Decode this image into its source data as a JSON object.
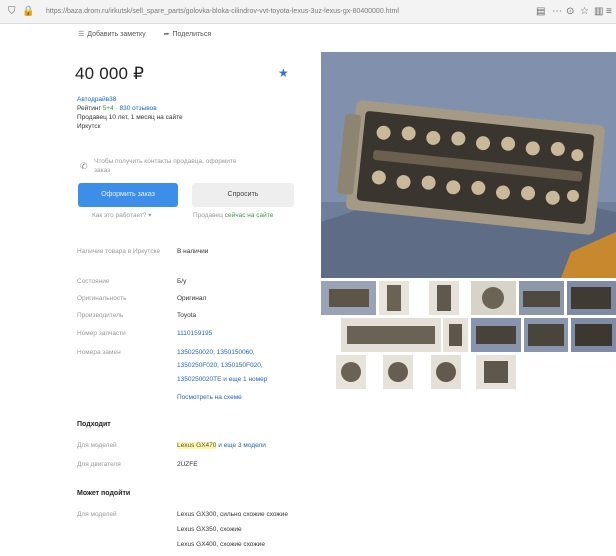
{
  "browser": {
    "url": "https://baza.drom.ru/irkutsk/sell_spare_parts/golovka-bloka-cilindrov-vvt-toyota-lexus-3uz-lexus-gx-80400000.html"
  },
  "actions": {
    "favorite": "Добавить заметку",
    "share": "Поделиться"
  },
  "price": "40 000 ₽",
  "seller": {
    "name": "Автодрайв38",
    "rating_label": "Рейтинг",
    "rating_value": "5+4",
    "reviews": "830 отзывов",
    "since": "Продавец 10 лет, 1 месяц на сайте",
    "city": "Иркутск"
  },
  "contact_note": "Чтобы получить контакты продавца, оформите заказ",
  "buttons": {
    "order": "Оформить заказ",
    "order_hint": "Как это работает?",
    "write": "Спросить",
    "write_hint_prefix": "Продавец",
    "write_hint_status": "сейчас на сайте"
  },
  "specs": {
    "availability_label": "Наличие товара в Иркутске",
    "availability_value": "В наличии",
    "condition_label": "Состояние",
    "condition_value": "Б/у",
    "originality_label": "Оригинальность",
    "originality_value": "Оригинал",
    "manufacturer_label": "Производитель",
    "manufacturer_value": "Toyota",
    "part_number_label": "Номер запчасти",
    "part_number_value": "1110159195",
    "replacements_label": "Номера замен",
    "replacements": [
      "1350250020, 1350150060,",
      "1350250F020, 1350150F020,",
      "1350250020TE"
    ],
    "replacements_more": "и еще 1 номер",
    "scheme_link": "Посмотреть на схеме"
  },
  "fits": {
    "title": "Подходит",
    "models_label": "Для моделей",
    "models_value": "Lexus GX470",
    "models_more": "и еще 3 модели",
    "engines_label": "Для двигателя",
    "engines_value": "2UZFE"
  },
  "may_fit": {
    "title": "Может подойти",
    "models_label": "Для моделей",
    "items": [
      "Lexus GX300, сильно схожие схожие",
      "Lexus GX350, схожие",
      "Lexus GX400, схожие схожие"
    ]
  }
}
